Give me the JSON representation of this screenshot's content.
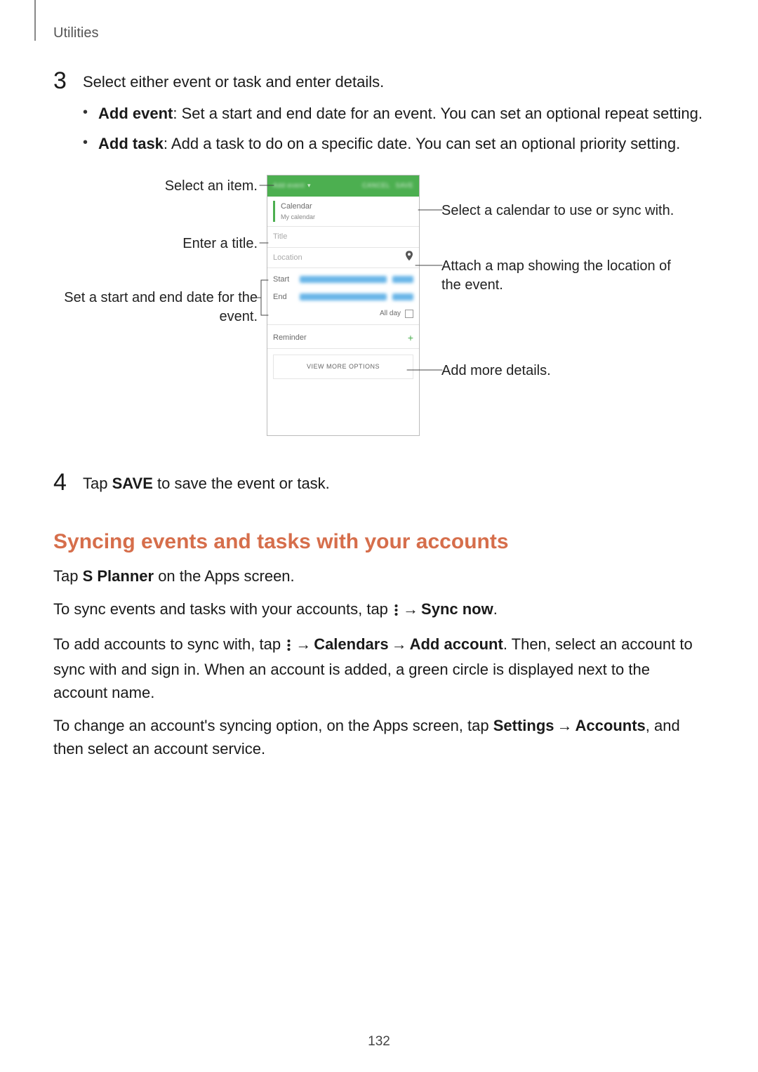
{
  "header": {
    "section": "Utilities"
  },
  "step3": {
    "num": "3",
    "intro": "Select either event or task and enter details.",
    "bullet1_b": "Add event",
    "bullet1_rest": ": Set a start and end date for an event. You can set an optional repeat setting.",
    "bullet2_b": "Add task",
    "bullet2_rest": ": Add a task to do on a specific date. You can set an optional priority setting."
  },
  "phone": {
    "top_add": "Add event",
    "top_cancel": "CANCEL",
    "top_save": "SAVE",
    "cal_label": "Calendar",
    "cal_sub": "My calendar",
    "title_ph": "Title",
    "loc_ph": "Location",
    "start": "Start",
    "end": "End",
    "allday": "All day",
    "reminder": "Reminder",
    "more": "VIEW MORE OPTIONS"
  },
  "callouts": {
    "select_item": "Select an item.",
    "enter_title": "Enter a title.",
    "dates": "Set a start and end date for the event.",
    "select_cal": "Select a calendar to use or sync with.",
    "attach_map": "Attach a map showing the location of the event.",
    "more_details": "Add more details."
  },
  "step4": {
    "num": "4",
    "pre": "Tap ",
    "save": "SAVE",
    "post": " to save the event or task."
  },
  "sync": {
    "heading": "Syncing events and tasks with your accounts",
    "p1_a": "Tap ",
    "p1_b": "S Planner",
    "p1_c": " on the Apps screen.",
    "p2_a": "To sync events and tasks with your accounts, tap ",
    "p2_b": "Sync now",
    "p2_c": ".",
    "p3_a": "To add accounts to sync with, tap ",
    "p3_b": "Calendars",
    "p3_c": "Add account",
    "p3_d": ". Then, select an account to sync with and sign in. When an account is added, a green circle is displayed next to the account name.",
    "p4_a": "To change an account's syncing option, on the Apps screen, tap ",
    "p4_b": "Settings",
    "p4_c": "Accounts",
    "p4_d": ", and then select an account service."
  },
  "page": "132"
}
